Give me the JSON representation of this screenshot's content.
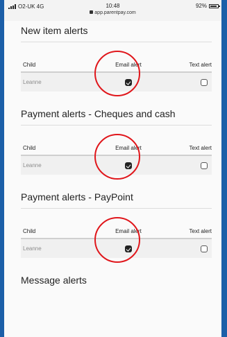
{
  "status_bar": {
    "carrier": "O2-UK 4G",
    "time": "10:48",
    "url": "app.parentpay.com",
    "battery": "92%",
    "battery_level": 0.92
  },
  "columns": {
    "child": "Child",
    "email": "Email alert",
    "text": "Text alert"
  },
  "sections": [
    {
      "title": "New item alerts",
      "child": "Leanne",
      "email_checked": true,
      "text_checked": false
    },
    {
      "title": "Payment alerts - Cheques and cash",
      "child": "Leanne",
      "email_checked": true,
      "text_checked": false
    },
    {
      "title": "Payment alerts - PayPoint",
      "child": "Leanne",
      "email_checked": true,
      "text_checked": false
    },
    {
      "title": "Message alerts"
    }
  ],
  "highlight_color": "#e0161b",
  "frame_color": "#1c5fa8"
}
